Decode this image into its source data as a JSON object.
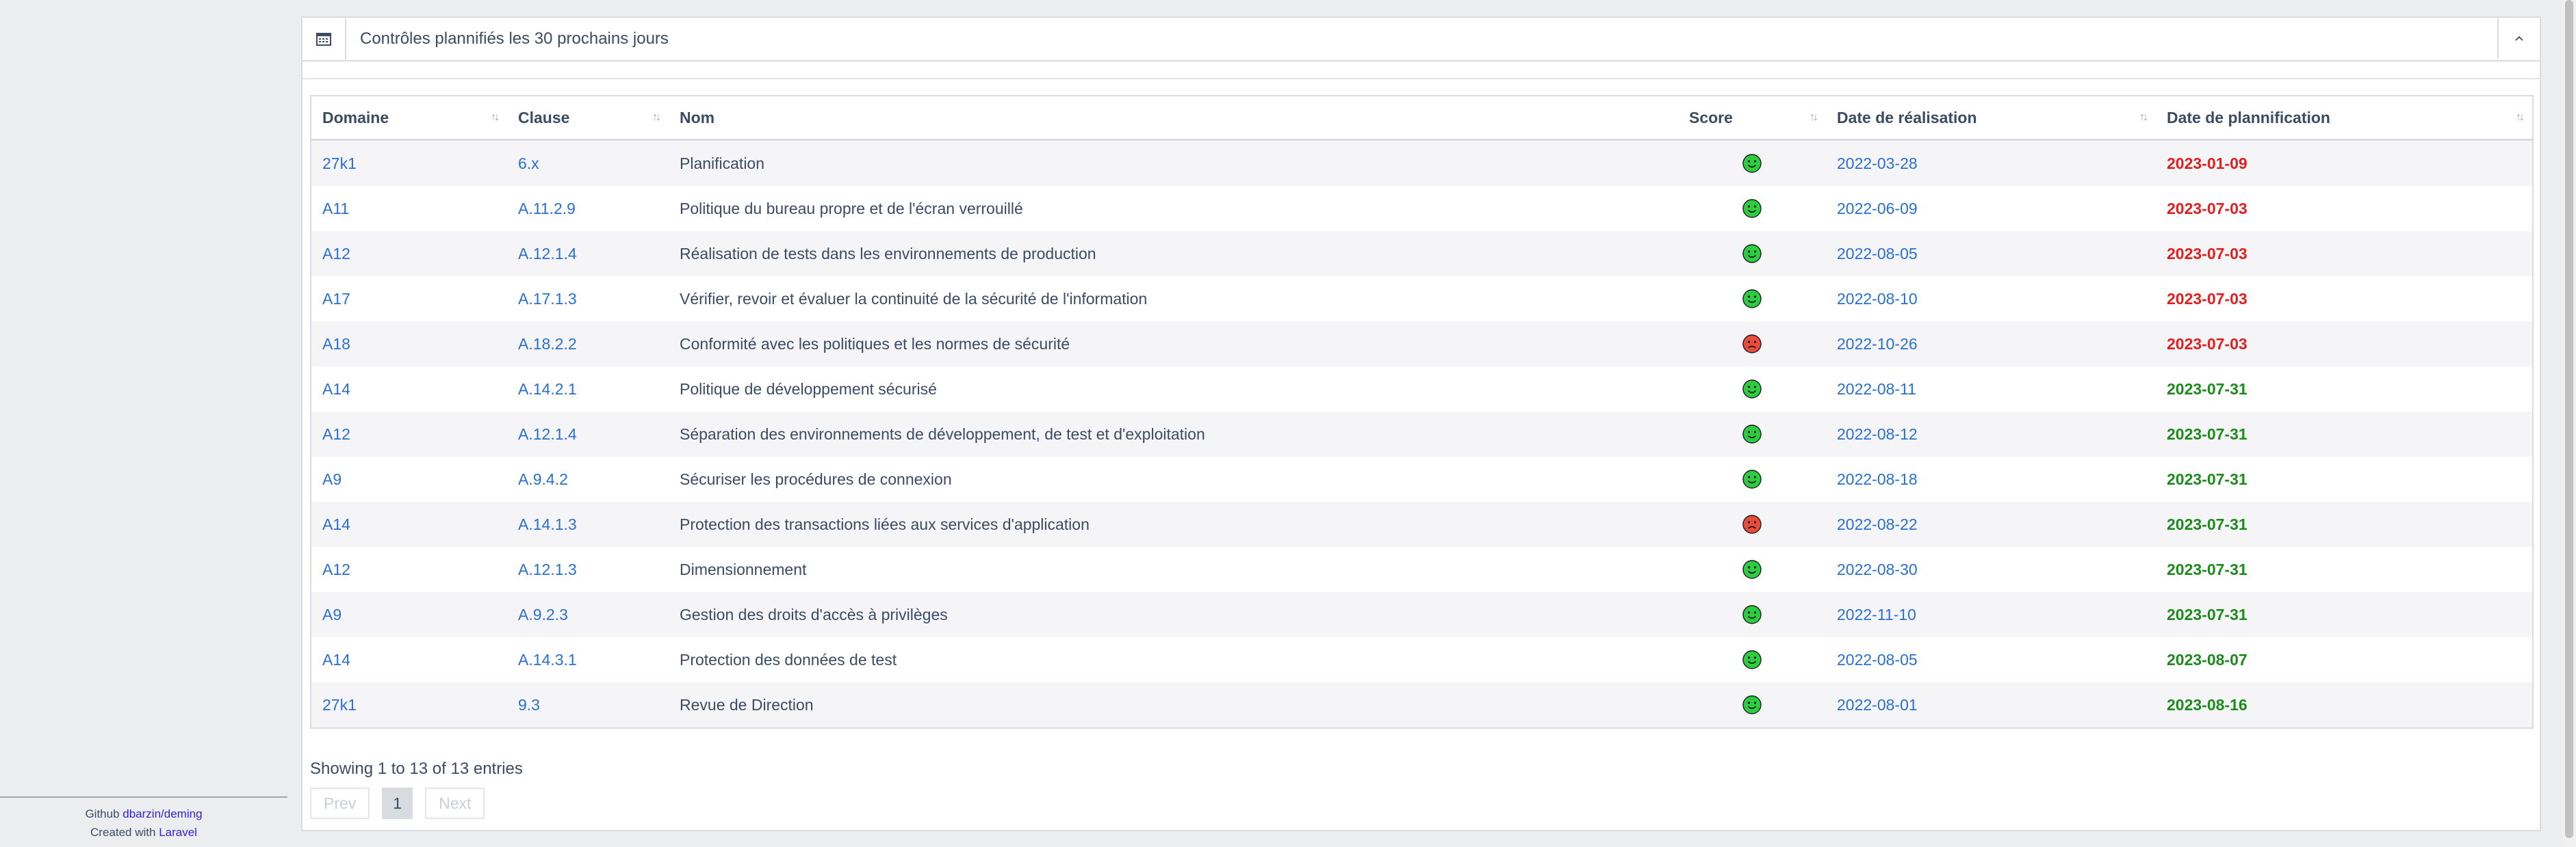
{
  "footer": {
    "github_label": "Github",
    "github_link": "dbarzin/deming",
    "created_label": "Created with",
    "created_link": "Laravel"
  },
  "card": {
    "title": "Contrôles plannifiés les 30 prochains jours"
  },
  "table": {
    "columns": [
      "Domaine",
      "Clause",
      "Nom",
      "Score",
      "Date de réalisation",
      "Date de plannification"
    ],
    "rows": [
      {
        "domaine": "27k1",
        "clause": "6.x",
        "nom": "Planification",
        "score": "green",
        "realisation": "2022-03-28",
        "plannification": "2023-01-09",
        "plan_status": "late"
      },
      {
        "domaine": "A11",
        "clause": "A.11.2.9",
        "nom": "Politique du bureau propre et de l'écran verrouillé",
        "score": "green",
        "realisation": "2022-06-09",
        "plannification": "2023-07-03",
        "plan_status": "late"
      },
      {
        "domaine": "A12",
        "clause": "A.12.1.4",
        "nom": "Réalisation de tests dans les environnements de production",
        "score": "green",
        "realisation": "2022-08-05",
        "plannification": "2023-07-03",
        "plan_status": "late"
      },
      {
        "domaine": "A17",
        "clause": "A.17.1.3",
        "nom": "Vérifier, revoir et évaluer la continuité de la sécurité de l'information",
        "score": "green",
        "realisation": "2022-08-10",
        "plannification": "2023-07-03",
        "plan_status": "late"
      },
      {
        "domaine": "A18",
        "clause": "A.18.2.2",
        "nom": "Conformité avec les politiques et les normes de sécurité",
        "score": "red",
        "realisation": "2022-10-26",
        "plannification": "2023-07-03",
        "plan_status": "late"
      },
      {
        "domaine": "A14",
        "clause": "A.14.2.1",
        "nom": "Politique de développement sécurisé",
        "score": "green",
        "realisation": "2022-08-11",
        "plannification": "2023-07-31",
        "plan_status": "ok"
      },
      {
        "domaine": "A12",
        "clause": "A.12.1.4",
        "nom": "Séparation des environnements de développement, de test et d'exploitation",
        "score": "green",
        "realisation": "2022-08-12",
        "plannification": "2023-07-31",
        "plan_status": "ok"
      },
      {
        "domaine": "A9",
        "clause": "A.9.4.2",
        "nom": "Sécuriser les procédures de connexion",
        "score": "green",
        "realisation": "2022-08-18",
        "plannification": "2023-07-31",
        "plan_status": "ok"
      },
      {
        "domaine": "A14",
        "clause": "A.14.1.3",
        "nom": "Protection des transactions liées aux services d'application",
        "score": "red",
        "realisation": "2022-08-22",
        "plannification": "2023-07-31",
        "plan_status": "ok"
      },
      {
        "domaine": "A12",
        "clause": "A.12.1.3",
        "nom": "Dimensionnement",
        "score": "green",
        "realisation": "2022-08-30",
        "plannification": "2023-07-31",
        "plan_status": "ok"
      },
      {
        "domaine": "A9",
        "clause": "A.9.2.3",
        "nom": "Gestion des droits d'accès à privilèges",
        "score": "green",
        "realisation": "2022-11-10",
        "plannification": "2023-07-31",
        "plan_status": "ok"
      },
      {
        "domaine": "A14",
        "clause": "A.14.3.1",
        "nom": "Protection des données de test",
        "score": "green",
        "realisation": "2022-08-05",
        "plannification": "2023-08-07",
        "plan_status": "ok"
      },
      {
        "domaine": "27k1",
        "clause": "9.3",
        "nom": "Revue de Direction",
        "score": "green",
        "realisation": "2022-08-01",
        "plannification": "2023-08-16",
        "plan_status": "ok"
      }
    ]
  },
  "info": "Showing 1 to 13 of 13 entries",
  "pagination": {
    "prev": "Prev",
    "current": "1",
    "next": "Next"
  },
  "colors": {
    "score_green": "#2ecc40",
    "score_red": "#e74c3c",
    "late": "#e02020",
    "ok": "#1e8a1e",
    "link": "#2a6fd1"
  }
}
